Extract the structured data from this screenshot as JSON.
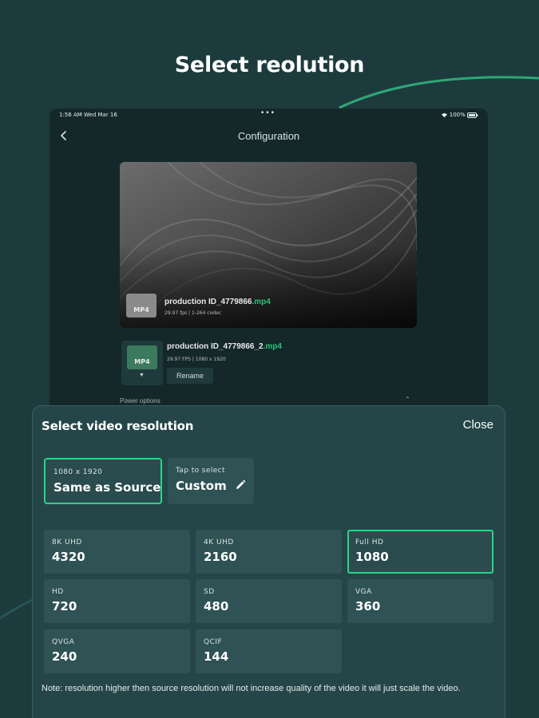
{
  "headline": "Select reolution",
  "device": {
    "status": {
      "time": "1:56 AM   Wed Mar 16",
      "dots": "•••",
      "battery": "100%"
    },
    "nav": {
      "title": "Configuration",
      "back_icon": "chevron-left-icon"
    },
    "source_file": {
      "thumb_label": "MP4",
      "name": "production ID_4779866",
      "ext": ".mp4",
      "meta": "29.97 fps  |  1-264 codec"
    },
    "output_file": {
      "thumb_label": "MP4",
      "name": "production ID_4779866_2",
      "ext": ".mp4",
      "meta": "29.97 FPS  |  1080 x 1920",
      "caret": "▼",
      "rename_label": "Rename"
    },
    "power_options_label": "Power options",
    "power_caret": "⌃"
  },
  "sheet": {
    "title": "Select video resolution",
    "close_label": "Close",
    "modes": [
      {
        "small": "1080 x 1920",
        "big": "Same as Source",
        "selected": true
      },
      {
        "small": "Tap to select",
        "big": "Custom",
        "icon": "pencil-icon",
        "selected": false
      }
    ],
    "resolutions": [
      {
        "label": "8K UHD",
        "value": "4320"
      },
      {
        "label": "4K UHD",
        "value": "2160"
      },
      {
        "label": "Full HD",
        "value": "1080",
        "selected": true
      },
      {
        "label": "HD",
        "value": "720"
      },
      {
        "label": "SD",
        "value": "480"
      },
      {
        "label": "VGA",
        "value": "360"
      },
      {
        "label": "QVGA",
        "value": "240"
      },
      {
        "label": "QCIF",
        "value": "144"
      }
    ],
    "note": "Note: resolution higher then source resolution will not increase quality of the video it will just scale the video."
  },
  "colors": {
    "background": "#1d3b3d",
    "sheet": "#254648",
    "card": "#2f5254",
    "accent": "#2bd38c",
    "ext_green": "#28c27a"
  }
}
